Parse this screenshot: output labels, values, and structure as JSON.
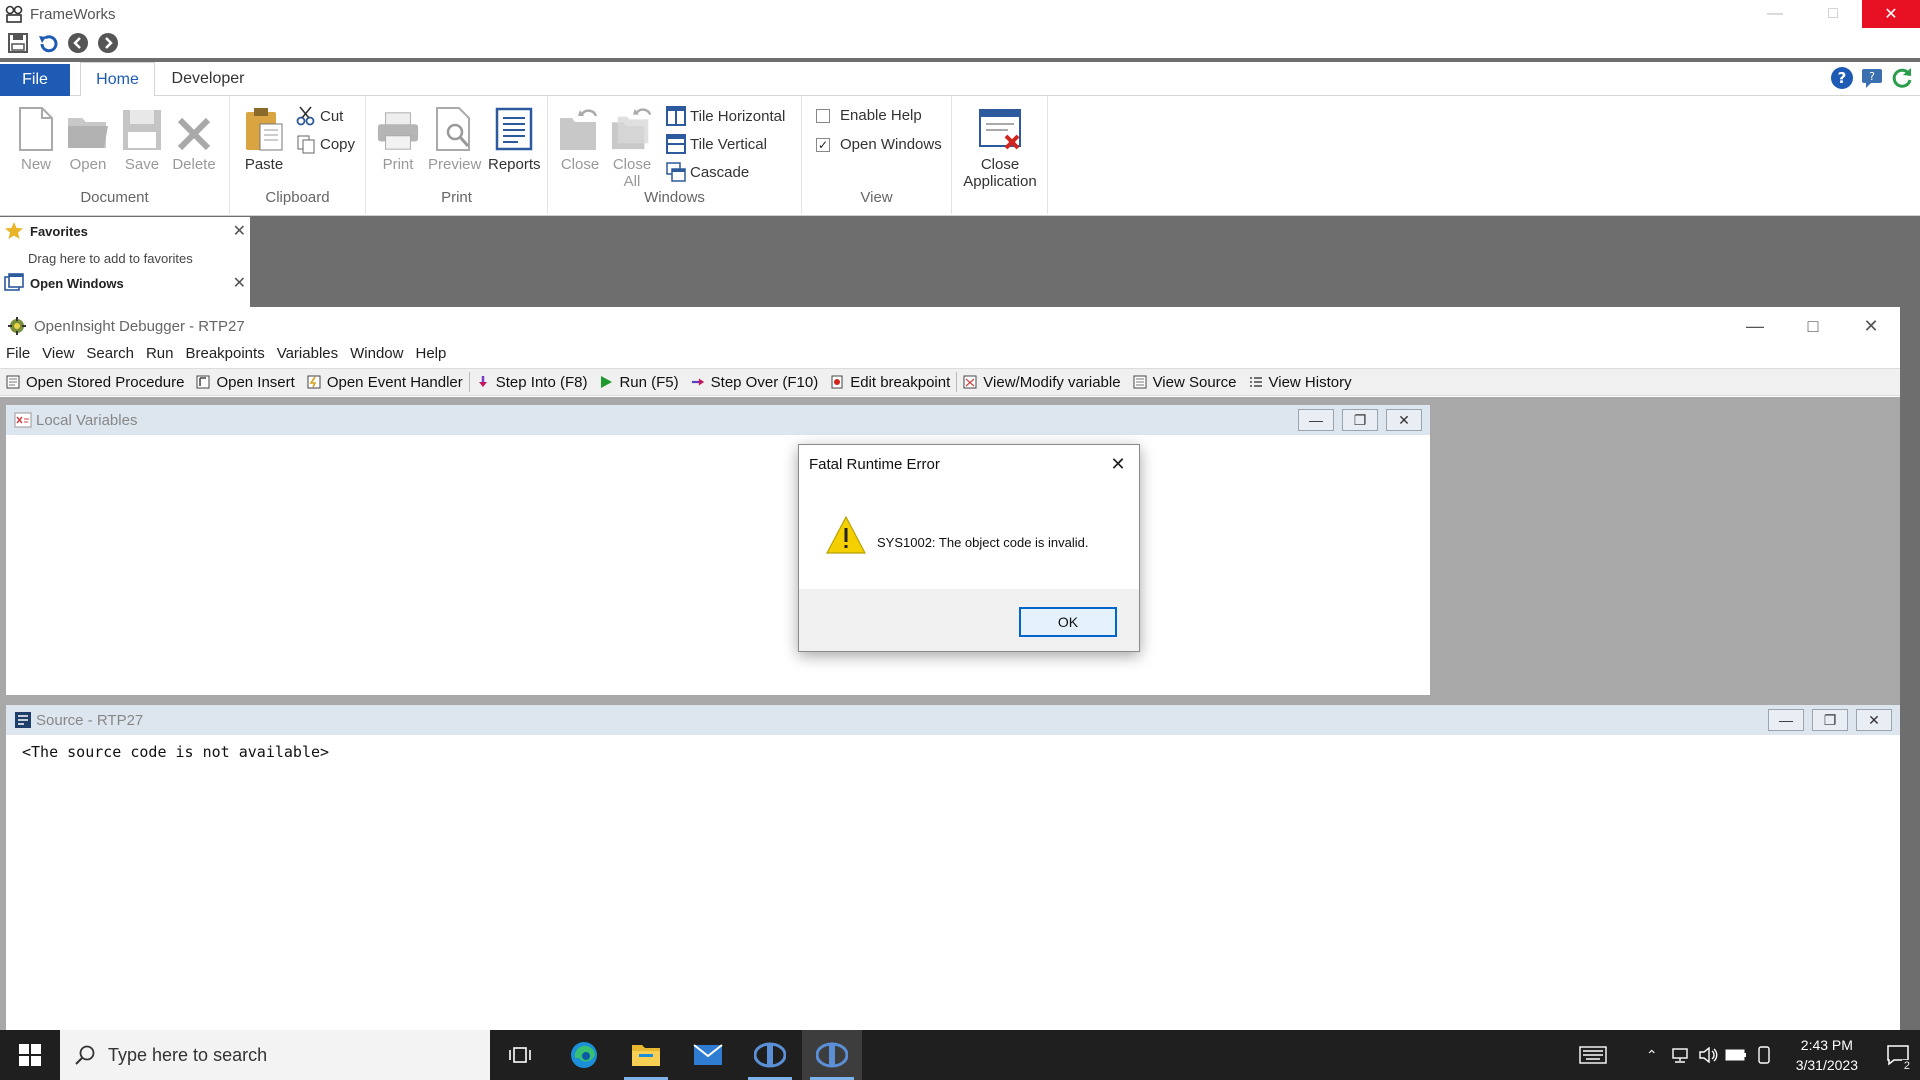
{
  "app": {
    "title": "FrameWorks"
  },
  "ribbon": {
    "tabs": [
      "File",
      "Home",
      "Developer"
    ],
    "active_tab": "Home",
    "groups": {
      "document": {
        "label": "Document",
        "buttons": [
          "New",
          "Open",
          "Save",
          "Delete"
        ]
      },
      "clipboard": {
        "label": "Clipboard",
        "paste": "Paste",
        "cut": "Cut",
        "copy": "Copy"
      },
      "print": {
        "label": "Print",
        "buttons": [
          "Print",
          "Preview",
          "Reports"
        ]
      },
      "windows": {
        "label": "Windows",
        "close": "Close",
        "close_all_line1": "Close",
        "close_all_line2": "All",
        "tile_horizontal": "Tile Horizontal",
        "tile_vertical": "Tile Vertical",
        "cascade": "Cascade"
      },
      "view": {
        "label": "View",
        "enable_help": "Enable Help",
        "enable_help_checked": false,
        "open_windows": "Open Windows",
        "open_windows_checked": true
      },
      "close_app": {
        "line1": "Close",
        "line2": "Application"
      }
    }
  },
  "favorites": {
    "title": "Favorites",
    "hint": "Drag here to add to favorites",
    "open_windows": "Open Windows"
  },
  "debugger": {
    "title": "OpenInsight Debugger - RTP27",
    "menu": [
      "File",
      "View",
      "Search",
      "Run",
      "Breakpoints",
      "Variables",
      "Window",
      "Help"
    ],
    "toolbar": [
      "Open Stored Procedure",
      "Open Insert",
      "Open Event Handler",
      "Step Into (F8)",
      "Run (F5)",
      "Step Over (F10)",
      "Edit breakpoint",
      "View/Modify variable",
      "View Source",
      "View History"
    ],
    "local_vars_title": "Local Variables",
    "source_title": "Source - RTP27",
    "source_text": "<The source code is not available>"
  },
  "dialog": {
    "title": "Fatal Runtime Error",
    "message": "SYS1002:  The object code is invalid.",
    "ok": "OK"
  },
  "taskbar": {
    "search_placeholder": "Type here to search",
    "time": "2:43 PM",
    "date": "3/31/2023",
    "notification_count": "2"
  },
  "colors": {
    "accent": "#1e5bb5",
    "close_red": "#e81123",
    "taskbar": "#1f1f1f"
  }
}
